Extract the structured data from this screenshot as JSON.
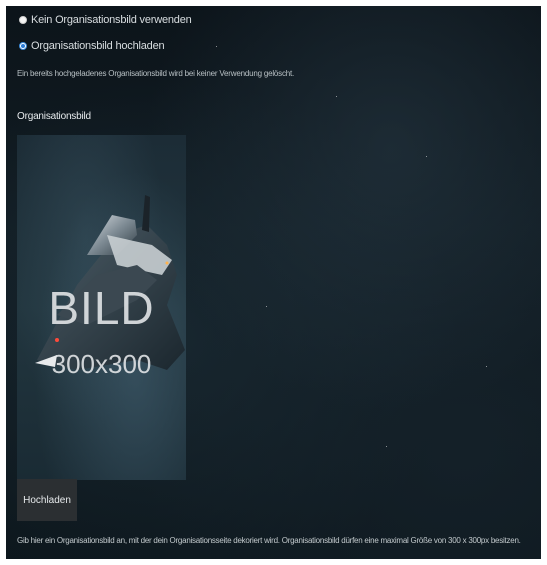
{
  "options": {
    "none_label": "Kein Organisationsbild verwenden",
    "upload_label": "Organisationsbild hochladen",
    "selected": "upload"
  },
  "note": "Ein bereits hochgeladenes Organisationsbild wird bei keiner Verwendung gelöscht.",
  "image_section": {
    "label": "Organisationsbild",
    "placeholder_title": "BILD",
    "placeholder_size": "300x300"
  },
  "upload_button": "Hochladen",
  "help_text": "Gib hier ein Organisationsbild an, mit der dein Organisationsseite dekoriert wird. Organisationsbild dürfen eine maximal Größe von 300 x 300px besitzen.",
  "colors": {
    "radio_accent": "#2a7bd6",
    "button_bg": "#2b2f32"
  }
}
